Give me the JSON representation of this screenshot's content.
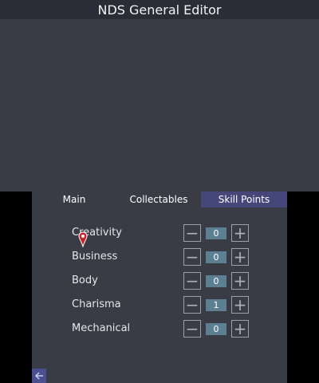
{
  "top_screen": {
    "title": "NDS General Editor"
  },
  "tabs": [
    {
      "label": "Main"
    },
    {
      "label": "Collectables"
    },
    {
      "label": "Skill Points"
    }
  ],
  "skills": [
    {
      "label": "Creativity",
      "value": "0"
    },
    {
      "label": "Business",
      "value": "0"
    },
    {
      "label": "Body",
      "value": "0"
    },
    {
      "label": "Charisma",
      "value": "1"
    },
    {
      "label": "Mechanical",
      "value": "0"
    }
  ],
  "icons": {
    "minus": "minus-icon",
    "plus": "plus-icon",
    "back": "back-arrow-icon",
    "cursor": "pointer-cursor-icon"
  }
}
